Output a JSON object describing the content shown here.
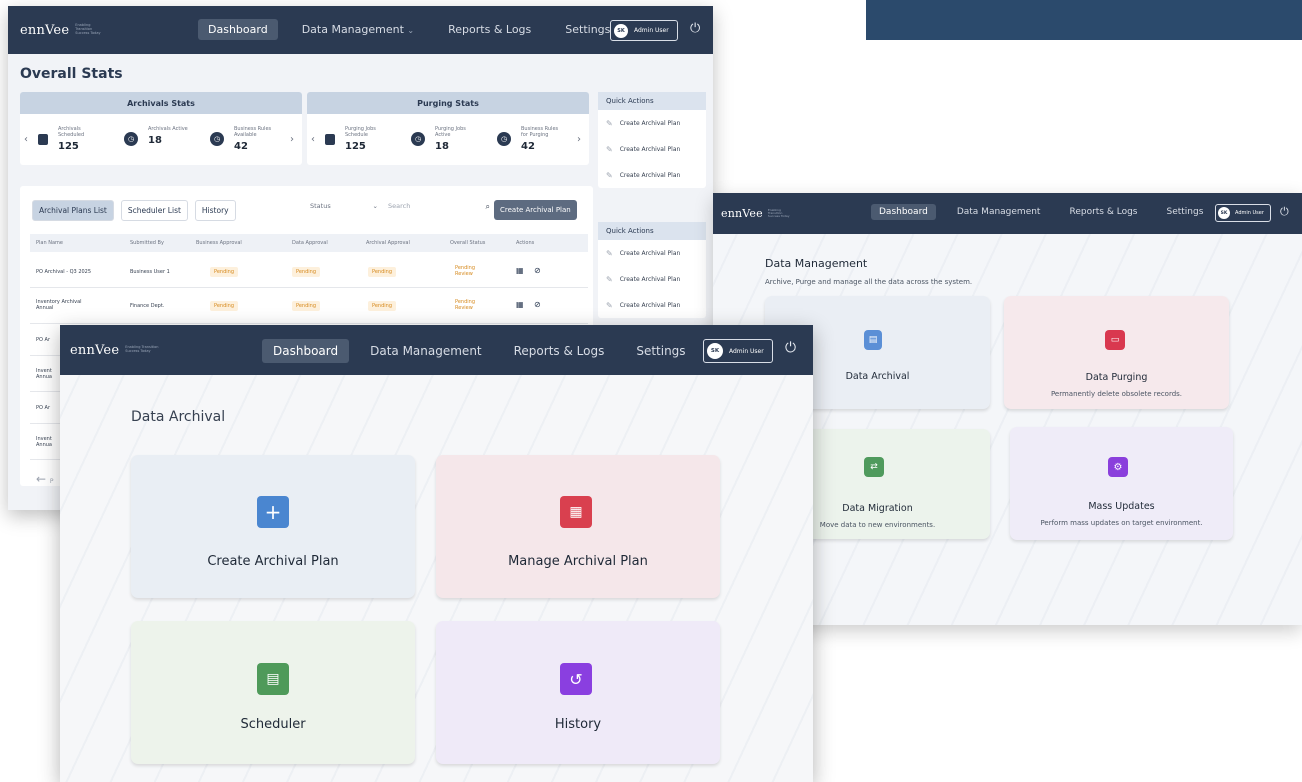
{
  "brand": {
    "logo": "ennVee",
    "tagline": "Enabling Transition Success Today"
  },
  "nav": {
    "dashboard": "Dashboard",
    "data_management": "Data Management",
    "data_management_caret": "⌄",
    "reports": "Reports & Logs",
    "settings": "Settings",
    "avatar": "SK",
    "user": "Admin User",
    "power": "⏻"
  },
  "overall": {
    "title": "Overall Stats",
    "archivals": {
      "heading": "Archivals Stats",
      "stats": [
        {
          "label": "Archivals Scheduled",
          "value": "125"
        },
        {
          "label": "Archivals Active",
          "value": "18"
        },
        {
          "label": "Business Rules Available",
          "value": "42"
        }
      ]
    },
    "purging": {
      "heading": "Purging Stats",
      "stats": [
        {
          "label": "Purging Jobs Schedule",
          "value": "125"
        },
        {
          "label": "Purging Jobs Active",
          "value": "18"
        },
        {
          "label": "Business Rules for Purging",
          "value": "42"
        }
      ]
    },
    "quick_actions": {
      "heading": "Quick Actions",
      "items": [
        "Create Archival Plan",
        "Create Archival Plan",
        "Create Archival Plan"
      ]
    },
    "tabs": [
      "Archival Plans List",
      "Scheduler List",
      "History"
    ],
    "status_placeholder": "Status",
    "search_placeholder": "Search",
    "create_button": "Create Archival Plan",
    "columns": [
      "Plan Name",
      "Submitted By",
      "Business Approval",
      "Data Approval",
      "Archival Approval",
      "Overall Status",
      "Actions"
    ],
    "rows": [
      {
        "plan": "PO Archival - Q3 2025",
        "by": "Business User 1",
        "business": "Pending",
        "data": "Pending",
        "archival": "Pending",
        "overall": "Pending Review"
      },
      {
        "plan": "Inventory Archival Annual",
        "by": "Finance Dept.",
        "business": "Pending",
        "data": "Pending",
        "archival": "Pending",
        "overall": "Pending Review"
      },
      {
        "plan": "PO Ar",
        "by": "",
        "business": "",
        "data": "",
        "archival": "",
        "overall": ""
      },
      {
        "plan": "Invent Annua",
        "by": "",
        "business": "",
        "data": "",
        "archival": "",
        "overall": ""
      },
      {
        "plan": "PO Ar",
        "by": "",
        "business": "",
        "data": "",
        "archival": "",
        "overall": ""
      },
      {
        "plan": "Invent Annua",
        "by": "",
        "business": "",
        "data": "",
        "archival": "",
        "overall": ""
      }
    ],
    "prev_label": "P"
  },
  "data_management": {
    "title": "Data Management",
    "subtitle": "Archive, Purge and manage all the data across the system.",
    "cards": [
      {
        "title": "Data Archival",
        "subtitle": "",
        "color": "#eaeef4",
        "icon_color": "#5b8fd6"
      },
      {
        "title": "Data Purging",
        "subtitle": "Permanently delete obsolete records.",
        "color": "#f6e9ec",
        "icon_color": "#d9384f"
      },
      {
        "title": "Data Migration",
        "subtitle": "Move data to new environments.",
        "color": "#ecf3ec",
        "icon_color": "#4f9a5d"
      },
      {
        "title": "Mass Updates",
        "subtitle": "Perform mass updates on target environment.",
        "color": "#efecf8",
        "icon_color": "#8a3fdc"
      }
    ]
  },
  "data_archival": {
    "title": "Data Archival",
    "cards": [
      {
        "title": "Create Archival Plan",
        "color": "#e9eef4",
        "icon_color": "#4a86d0",
        "icon": "create-plan-icon"
      },
      {
        "title": "Manage Archival Plan",
        "color": "#f5e7ea",
        "icon_color": "#d9404f",
        "icon": "manage-plan-icon"
      },
      {
        "title": "Scheduler",
        "color": "#edf3eb",
        "icon_color": "#4f9a5a",
        "icon": "calendar-icon"
      },
      {
        "title": "History",
        "color": "#efeaf8",
        "icon_color": "#8a3fe0",
        "icon": "history-icon"
      }
    ]
  }
}
